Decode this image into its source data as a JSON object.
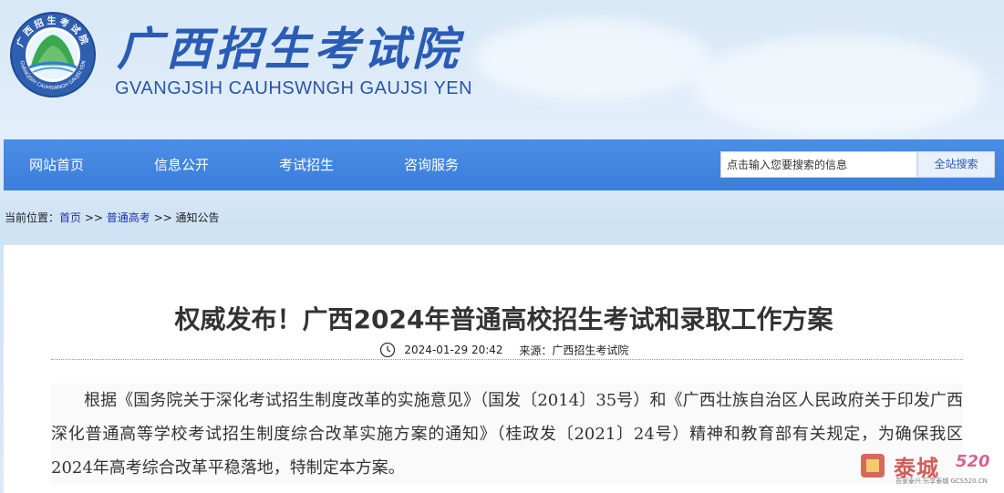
{
  "header": {
    "title_cn": "广西招生考试院",
    "title_en": "GVANGJSIH CAUHSWNGH GAUJSI YEN",
    "logo_ring_text": "GVANGJSIH CAUHSWNGH GAUJSI YEN",
    "logo_ring_text_cn": "广西招生考试院"
  },
  "nav": {
    "items": [
      {
        "label": "网站首页"
      },
      {
        "label": "信息公开"
      },
      {
        "label": "考试招生"
      },
      {
        "label": "咨询服务"
      }
    ],
    "search_placeholder": "点击输入您要搜索的信息",
    "search_button": "全站搜索"
  },
  "breadcrumb": {
    "prefix": "当前位置：",
    "links": [
      "首页",
      "普通高考"
    ],
    "separator": " >> ",
    "current": "通知公告"
  },
  "article": {
    "title": "权威发布！广西2024年普通高校招生考试和录取工作方案",
    "date": "2024-01-29 20:42",
    "source_label": "来源：",
    "source": "广西招生考试院",
    "paragraph": "根据《国务院关于深化考试招生制度改革的实施意见》（国发〔2014〕35号）和《广西壮族自治区人民政府关于印发广西深化普通高等学校考试招生制度综合改革实施方案的通知》（桂政发〔2021〕24号）精神和教育部有关规定，为确保我区2024年高考综合改革平稳落地，特制定本方案。"
  },
  "watermark": {
    "text": "泰城",
    "num": "520",
    "sub": "吾家泰兴·乐享泰城 GCS520.CN"
  },
  "colors": {
    "nav_bg": "#3b7edb",
    "title_blue": "#2a5bb5",
    "link": "#2233aa"
  }
}
